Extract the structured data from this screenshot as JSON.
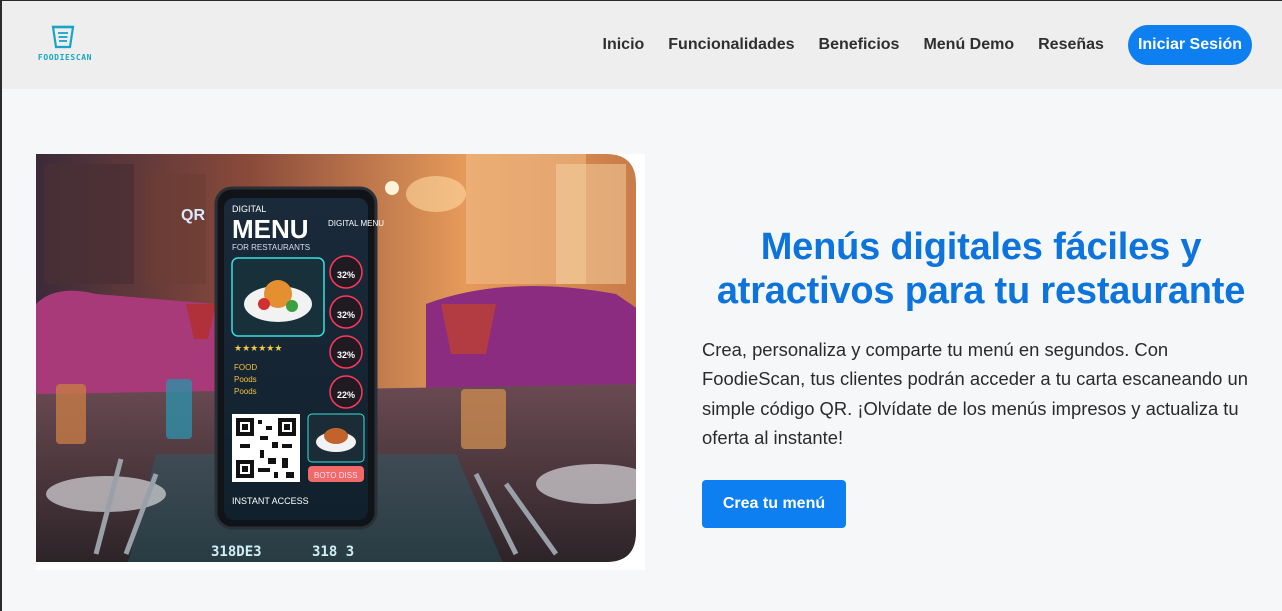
{
  "brand": {
    "name": "FOODIESCAN",
    "logo_icon": "menu-card-icon",
    "color": "#17a5c7"
  },
  "nav": {
    "links": [
      "Inicio",
      "Funcionalidades",
      "Beneficios",
      "Menú Demo",
      "Reseñas"
    ],
    "login_label": "Iniciar Sesión"
  },
  "hero": {
    "title": "Menús digitales fáciles y atractivos para tu restaurante",
    "description": "Crea, personaliza y comparte tu menú en segundos. Con FoodieScan, tus clientes podrán acceder a tu carta escaneando un simple código QR. ¡Olvídate de los menús impresos y actualiza tu oferta al instante!",
    "cta_label": "Crea tu menú",
    "image": {
      "qr_label": "QR",
      "menu_kicker": "DIGITAL",
      "menu_title": "MENU",
      "menu_subtitle": "FOR RESTAURANTS",
      "menu_side": "DIGITAL MENU",
      "percents": [
        "32%",
        "32%",
        "32%",
        "22%"
      ],
      "list_labels": [
        "FOOD",
        "Poods",
        "Poods"
      ],
      "offer_label": "BOTO DISS",
      "access_label": "INSTANT ACCESS",
      "table_codes": [
        "318DE3",
        "318 3"
      ]
    }
  },
  "colors": {
    "accent": "#0d7ff0",
    "title": "#0c74dc",
    "header_bg": "#eeeeee",
    "page_bg": "#f6f7f9"
  }
}
